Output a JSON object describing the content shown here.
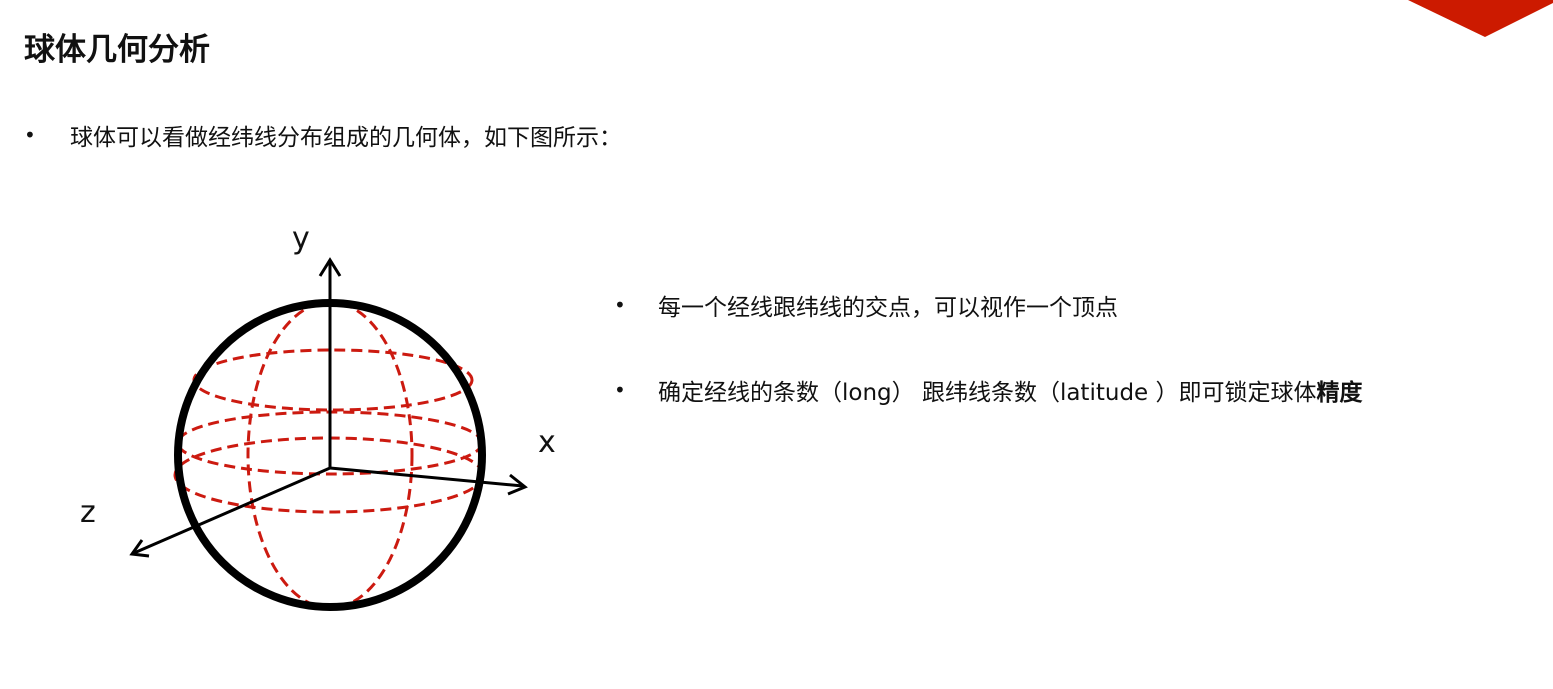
{
  "slide": {
    "title": "球体几何分析",
    "bullets": [
      {
        "text": "球体可以看做经纬线分布组成的几何体，如下图所示："
      },
      {
        "text": "每一个经线跟纬线的交点，可以视作一个顶点"
      },
      {
        "text_before": "确定经线的条数（long） 跟纬线条数（latitude ）即可锁定球体",
        "text_bold": "精度"
      }
    ],
    "bullet_symbol": "•"
  },
  "diagram": {
    "axis_labels": {
      "x": "x",
      "y": "y",
      "z": "z"
    },
    "colors": {
      "outline": "#000000",
      "grid": "#cc1a10",
      "accent": "#cc1a00"
    }
  }
}
